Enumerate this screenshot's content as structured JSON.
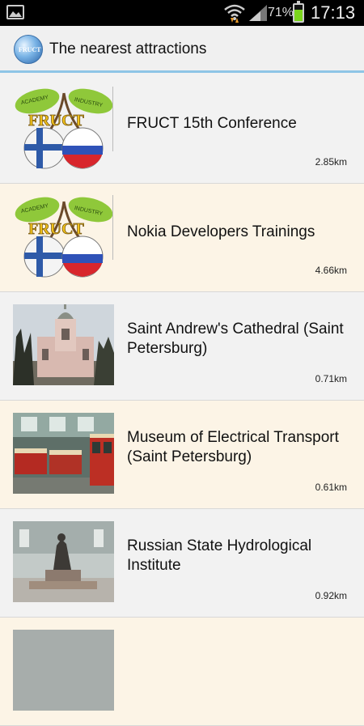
{
  "status_bar": {
    "battery_percent": "71%",
    "battery_level": 0.71,
    "time": "17:13",
    "icons": [
      "gallery-icon",
      "wifi-icon",
      "signal-icon",
      "battery-icon"
    ]
  },
  "action_bar": {
    "app_icon_text": "FRUCT",
    "title": "The nearest attractions"
  },
  "items": [
    {
      "title": "FRUCT 15th Conference",
      "distance": "2.85km",
      "image": "fruct-logo"
    },
    {
      "title": "Nokia Developers Trainings",
      "distance": "4.66km",
      "image": "fruct-logo"
    },
    {
      "title": "Saint Andrew's Cathedral (Saint Petersburg)",
      "distance": "0.71km",
      "image": "cathedral-photo"
    },
    {
      "title": "Museum of Electrical Transport (Saint Petersburg)",
      "distance": "0.61km",
      "image": "tram-depot-photo"
    },
    {
      "title": "Russian State Hydrological Institute",
      "distance": "0.92km",
      "image": "monument-photo"
    }
  ],
  "logo_text": {
    "left_leaf": "ACADEMY",
    "right_leaf": "INDUSTRY",
    "word": "FRUCT"
  },
  "colors": {
    "action_bar_underline": "#8ec5e6",
    "row_odd": "#f2f2f2",
    "row_even": "#fcf4e6"
  }
}
